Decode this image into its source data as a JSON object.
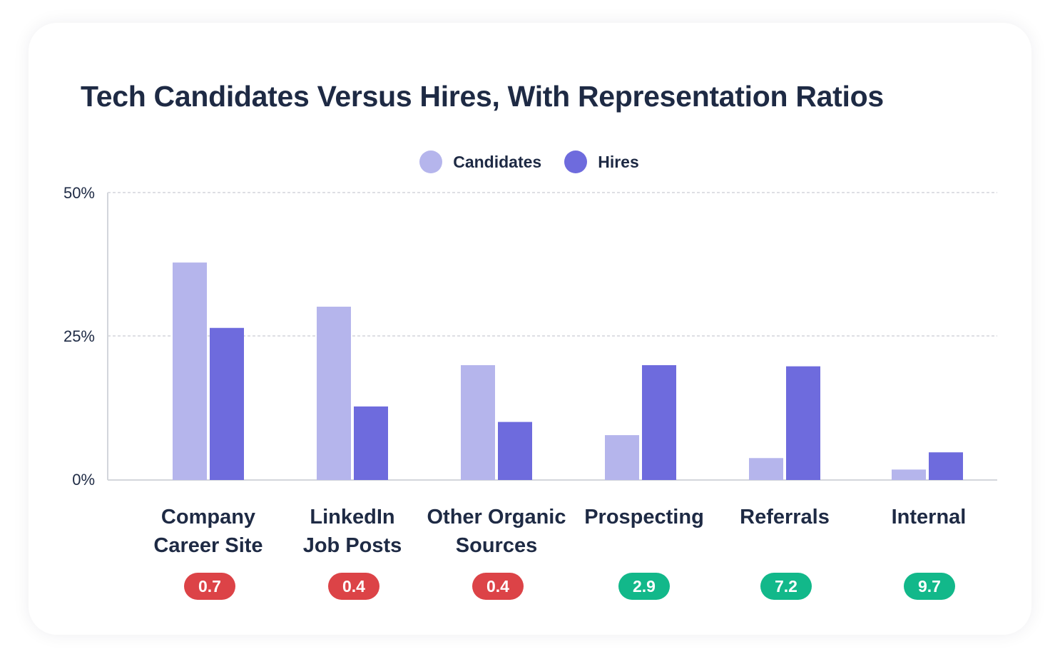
{
  "title": "Tech Candidates Versus Hires, With Representation Ratios",
  "colors": {
    "candidates": "#b5b5ec",
    "hires": "#6e6bdd",
    "ratio_low": "#dc4347",
    "ratio_high": "#12b88a",
    "text": "#1e2a44",
    "grid": "#c9ccd3",
    "axis": "#d3d6db"
  },
  "chart_data": {
    "type": "bar",
    "title": "Tech Candidates Versus Hires, With Representation Ratios",
    "xlabel": "",
    "ylabel": "",
    "ylim": [
      0,
      50
    ],
    "yticks": [
      0,
      25,
      50
    ],
    "ytick_labels": [
      "0%",
      "25%",
      "50%"
    ],
    "grid": true,
    "legend_position": "top-center",
    "categories": [
      [
        "Company",
        "Career Site"
      ],
      [
        "LinkedIn",
        "Job Posts"
      ],
      [
        "Other Organic",
        "Sources"
      ],
      [
        "Prospecting"
      ],
      [
        "Referrals"
      ],
      [
        "Internal"
      ]
    ],
    "series": [
      {
        "name": "Candidates",
        "values": [
          37.8,
          30.1,
          19.9,
          7.7,
          3.7,
          1.7
        ]
      },
      {
        "name": "Hires",
        "values": [
          26.4,
          12.7,
          10.0,
          19.9,
          19.7,
          4.7
        ]
      }
    ],
    "annotations": {
      "representation_ratios": [
        "0.7",
        "0.4",
        "0.4",
        "2.9",
        "7.2",
        "9.7"
      ],
      "ratio_status": [
        "low",
        "low",
        "low",
        "high",
        "high",
        "high"
      ]
    }
  }
}
